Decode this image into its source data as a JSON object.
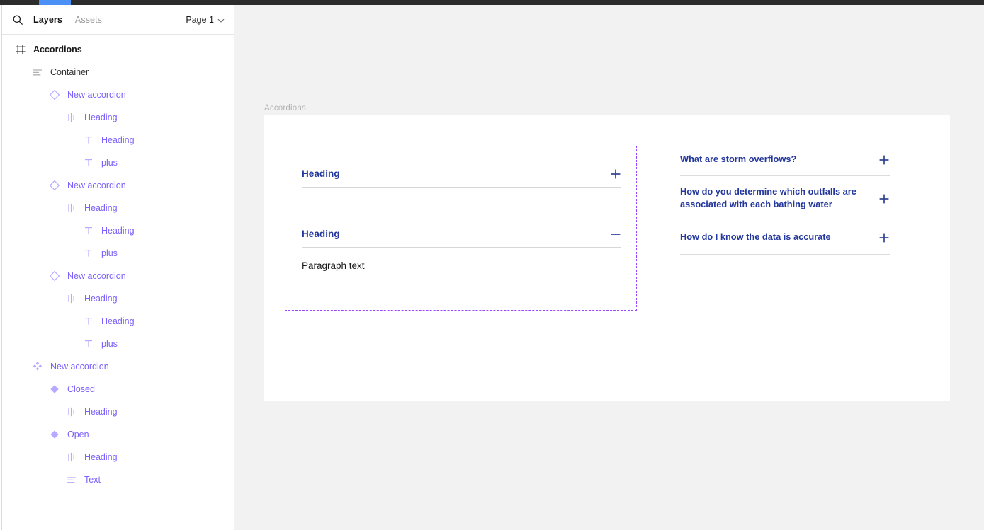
{
  "window": {
    "topbar": {
      "tab_color": "#4a90f5",
      "bar_color": "#2c2c2c"
    }
  },
  "sidebar": {
    "search_icon": "search-icon",
    "tabs": [
      {
        "label": "Layers",
        "active": true
      },
      {
        "label": "Assets",
        "active": false
      }
    ],
    "page_selector": {
      "label": "Page 1",
      "icon": "chevron-down-icon"
    },
    "layers": [
      {
        "name": "Accordions",
        "icon": "frame-icon",
        "depth": 0,
        "style": "frame"
      },
      {
        "name": "Container",
        "icon": "auto-layout-icon",
        "depth": 1,
        "style": "plain"
      },
      {
        "name": "New accordion",
        "icon": "instance-icon",
        "depth": 2,
        "style": "purple"
      },
      {
        "name": "Heading",
        "icon": "auto-layout-h-icon",
        "depth": 3,
        "style": "purple"
      },
      {
        "name": "Heading",
        "icon": "text-icon",
        "depth": 4,
        "style": "purple"
      },
      {
        "name": "plus",
        "icon": "text-icon",
        "depth": 4,
        "style": "purple"
      },
      {
        "name": "New accordion",
        "icon": "instance-icon",
        "depth": 2,
        "style": "purple"
      },
      {
        "name": "Heading",
        "icon": "auto-layout-h-icon",
        "depth": 3,
        "style": "purple"
      },
      {
        "name": "Heading",
        "icon": "text-icon",
        "depth": 4,
        "style": "purple"
      },
      {
        "name": "plus",
        "icon": "text-icon",
        "depth": 4,
        "style": "purple"
      },
      {
        "name": "New accordion",
        "icon": "instance-icon",
        "depth": 2,
        "style": "purple"
      },
      {
        "name": "Heading",
        "icon": "auto-layout-h-icon",
        "depth": 3,
        "style": "purple"
      },
      {
        "name": "Heading",
        "icon": "text-icon",
        "depth": 4,
        "style": "purple"
      },
      {
        "name": "plus",
        "icon": "text-icon",
        "depth": 4,
        "style": "purple"
      },
      {
        "name": "New accordion",
        "icon": "component-set-icon",
        "depth": 1,
        "style": "purple"
      },
      {
        "name": "Closed",
        "icon": "component-icon",
        "depth": 2,
        "style": "purple"
      },
      {
        "name": "Heading",
        "icon": "auto-layout-h-icon",
        "depth": 3,
        "style": "purple"
      },
      {
        "name": "Open",
        "icon": "component-icon",
        "depth": 2,
        "style": "purple"
      },
      {
        "name": "Heading",
        "icon": "auto-layout-h-icon",
        "depth": 3,
        "style": "purple"
      },
      {
        "name": "Text",
        "icon": "auto-layout-icon",
        "depth": 3,
        "style": "purple"
      }
    ]
  },
  "canvas": {
    "frame_label": "Accordions",
    "selection_color": "#9747ff",
    "heading_color": "#23379c",
    "accordions_left": [
      {
        "title": "Heading",
        "sign": "plus-icon",
        "body": null
      },
      {
        "title": "Heading",
        "sign": "minus-icon",
        "body": "Paragraph text"
      }
    ],
    "faq": [
      {
        "question": "What are storm overflows?",
        "sign": "plus-icon"
      },
      {
        "question": "How do you determine which outfalls are associated with each bathing water",
        "sign": "plus-icon"
      },
      {
        "question": "How do I know the data is accurate",
        "sign": "plus-icon"
      }
    ]
  }
}
